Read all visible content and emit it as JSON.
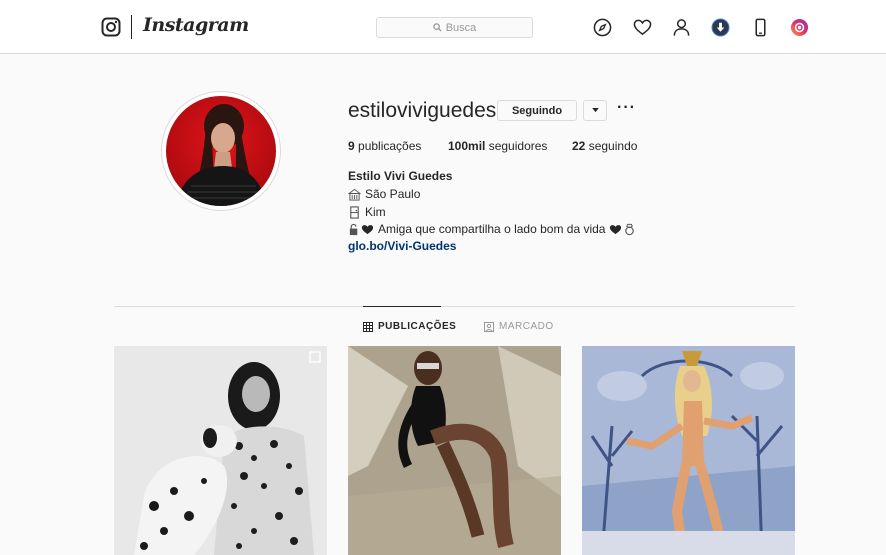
{
  "nav": {
    "wordmark": "Instagram",
    "search_placeholder": "Busca",
    "icons": [
      "instagram-glyph-icon",
      "compass-icon",
      "heart-icon",
      "person-icon",
      "download-icon",
      "mobile-icon",
      "instagram-gradient-icon"
    ]
  },
  "profile": {
    "username": "estiloviviguedes",
    "follow_label": "Seguindo",
    "stats": {
      "posts_count": "9",
      "posts_label": "publicações",
      "followers_count": "100mil",
      "followers_label": "seguidores",
      "following_count": "22",
      "following_label": "seguindo"
    },
    "full_name": "Estilo Vivi Guedes",
    "bio": {
      "line1": "São Paulo",
      "line2": "Kim",
      "line3": "Amiga que compartilha o lado bom da vida"
    },
    "link": "glo.bo/Vivi-Guedes"
  },
  "tabs": {
    "posts": "PUBLICAÇÕES",
    "tagged": "MARCADO"
  },
  "colors": {
    "background": "#fafafa",
    "border": "#dbdbdb",
    "text": "#262626",
    "link": "#003569"
  }
}
